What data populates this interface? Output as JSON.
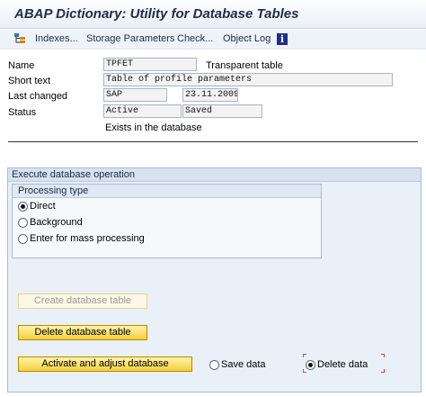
{
  "window": {
    "title": "ABAP Dictionary: Utility for Database Tables"
  },
  "toolbar": {
    "items": [
      {
        "label": "Indexes..."
      },
      {
        "label": "Storage Parameters"
      },
      {
        "label": "Check..."
      },
      {
        "label": "Object Log"
      }
    ],
    "info_glyph": "i"
  },
  "header": {
    "name_label": "Name",
    "name_value": "TPFET",
    "table_type": "Transparent table",
    "short_text_label": "Short text",
    "short_text_value": "Table of profile parameters",
    "last_changed_label": "Last changed",
    "last_changed_user": "SAP",
    "last_changed_date": "23.11.2009",
    "status_label": "Status",
    "status_value1": "Active",
    "status_value2": "Saved",
    "db_state": "Exists in the database"
  },
  "execute": {
    "title": "Execute database operation",
    "processing_type": {
      "title": "Processing type",
      "options": [
        {
          "label": "Direct",
          "selected": true
        },
        {
          "label": "Background",
          "selected": false
        },
        {
          "label": "Enter for mass processing",
          "selected": false
        }
      ]
    },
    "buttons": {
      "create": "Create database table",
      "delete": "Delete database table",
      "activate": "Activate and adjust database"
    },
    "data_options": [
      {
        "label": "Save data",
        "selected": false
      },
      {
        "label": "Delete data",
        "selected": true
      }
    ]
  }
}
